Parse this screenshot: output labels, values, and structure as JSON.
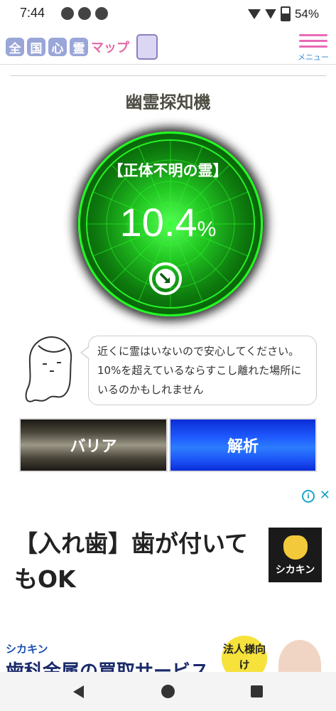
{
  "status_bar": {
    "time": "7:44",
    "battery": "54%"
  },
  "header": {
    "logo_chars": [
      "全",
      "国",
      "心",
      "霊"
    ],
    "logo_sub": "マップ",
    "menu_label": "メニュー"
  },
  "page": {
    "title": "幽霊探知機"
  },
  "radar": {
    "label": "【正体不明の霊】",
    "value": "10.4",
    "unit": "%",
    "level_fraction": 0.104
  },
  "speech": {
    "text": "近くに霊はいないので安心してください。10%を超えているならすこし離れた場所にいるのかもしれません"
  },
  "buttons": {
    "barrier": "バリア",
    "analyze": "解析"
  },
  "ad": {
    "headline": "【入れ歯】歯が付いてもOK",
    "logo_text": "シカキン",
    "info": "i",
    "close": "✕"
  },
  "banner": {
    "brand": "シカキン",
    "text": "歯科金属の買取サービス",
    "badge": "法人様向け"
  },
  "colors": {
    "radar_green": "#1eff1e",
    "barrier_button": "#4a463a",
    "analyze_button": "#1f5bff",
    "menu_pink": "#e86ab8"
  }
}
